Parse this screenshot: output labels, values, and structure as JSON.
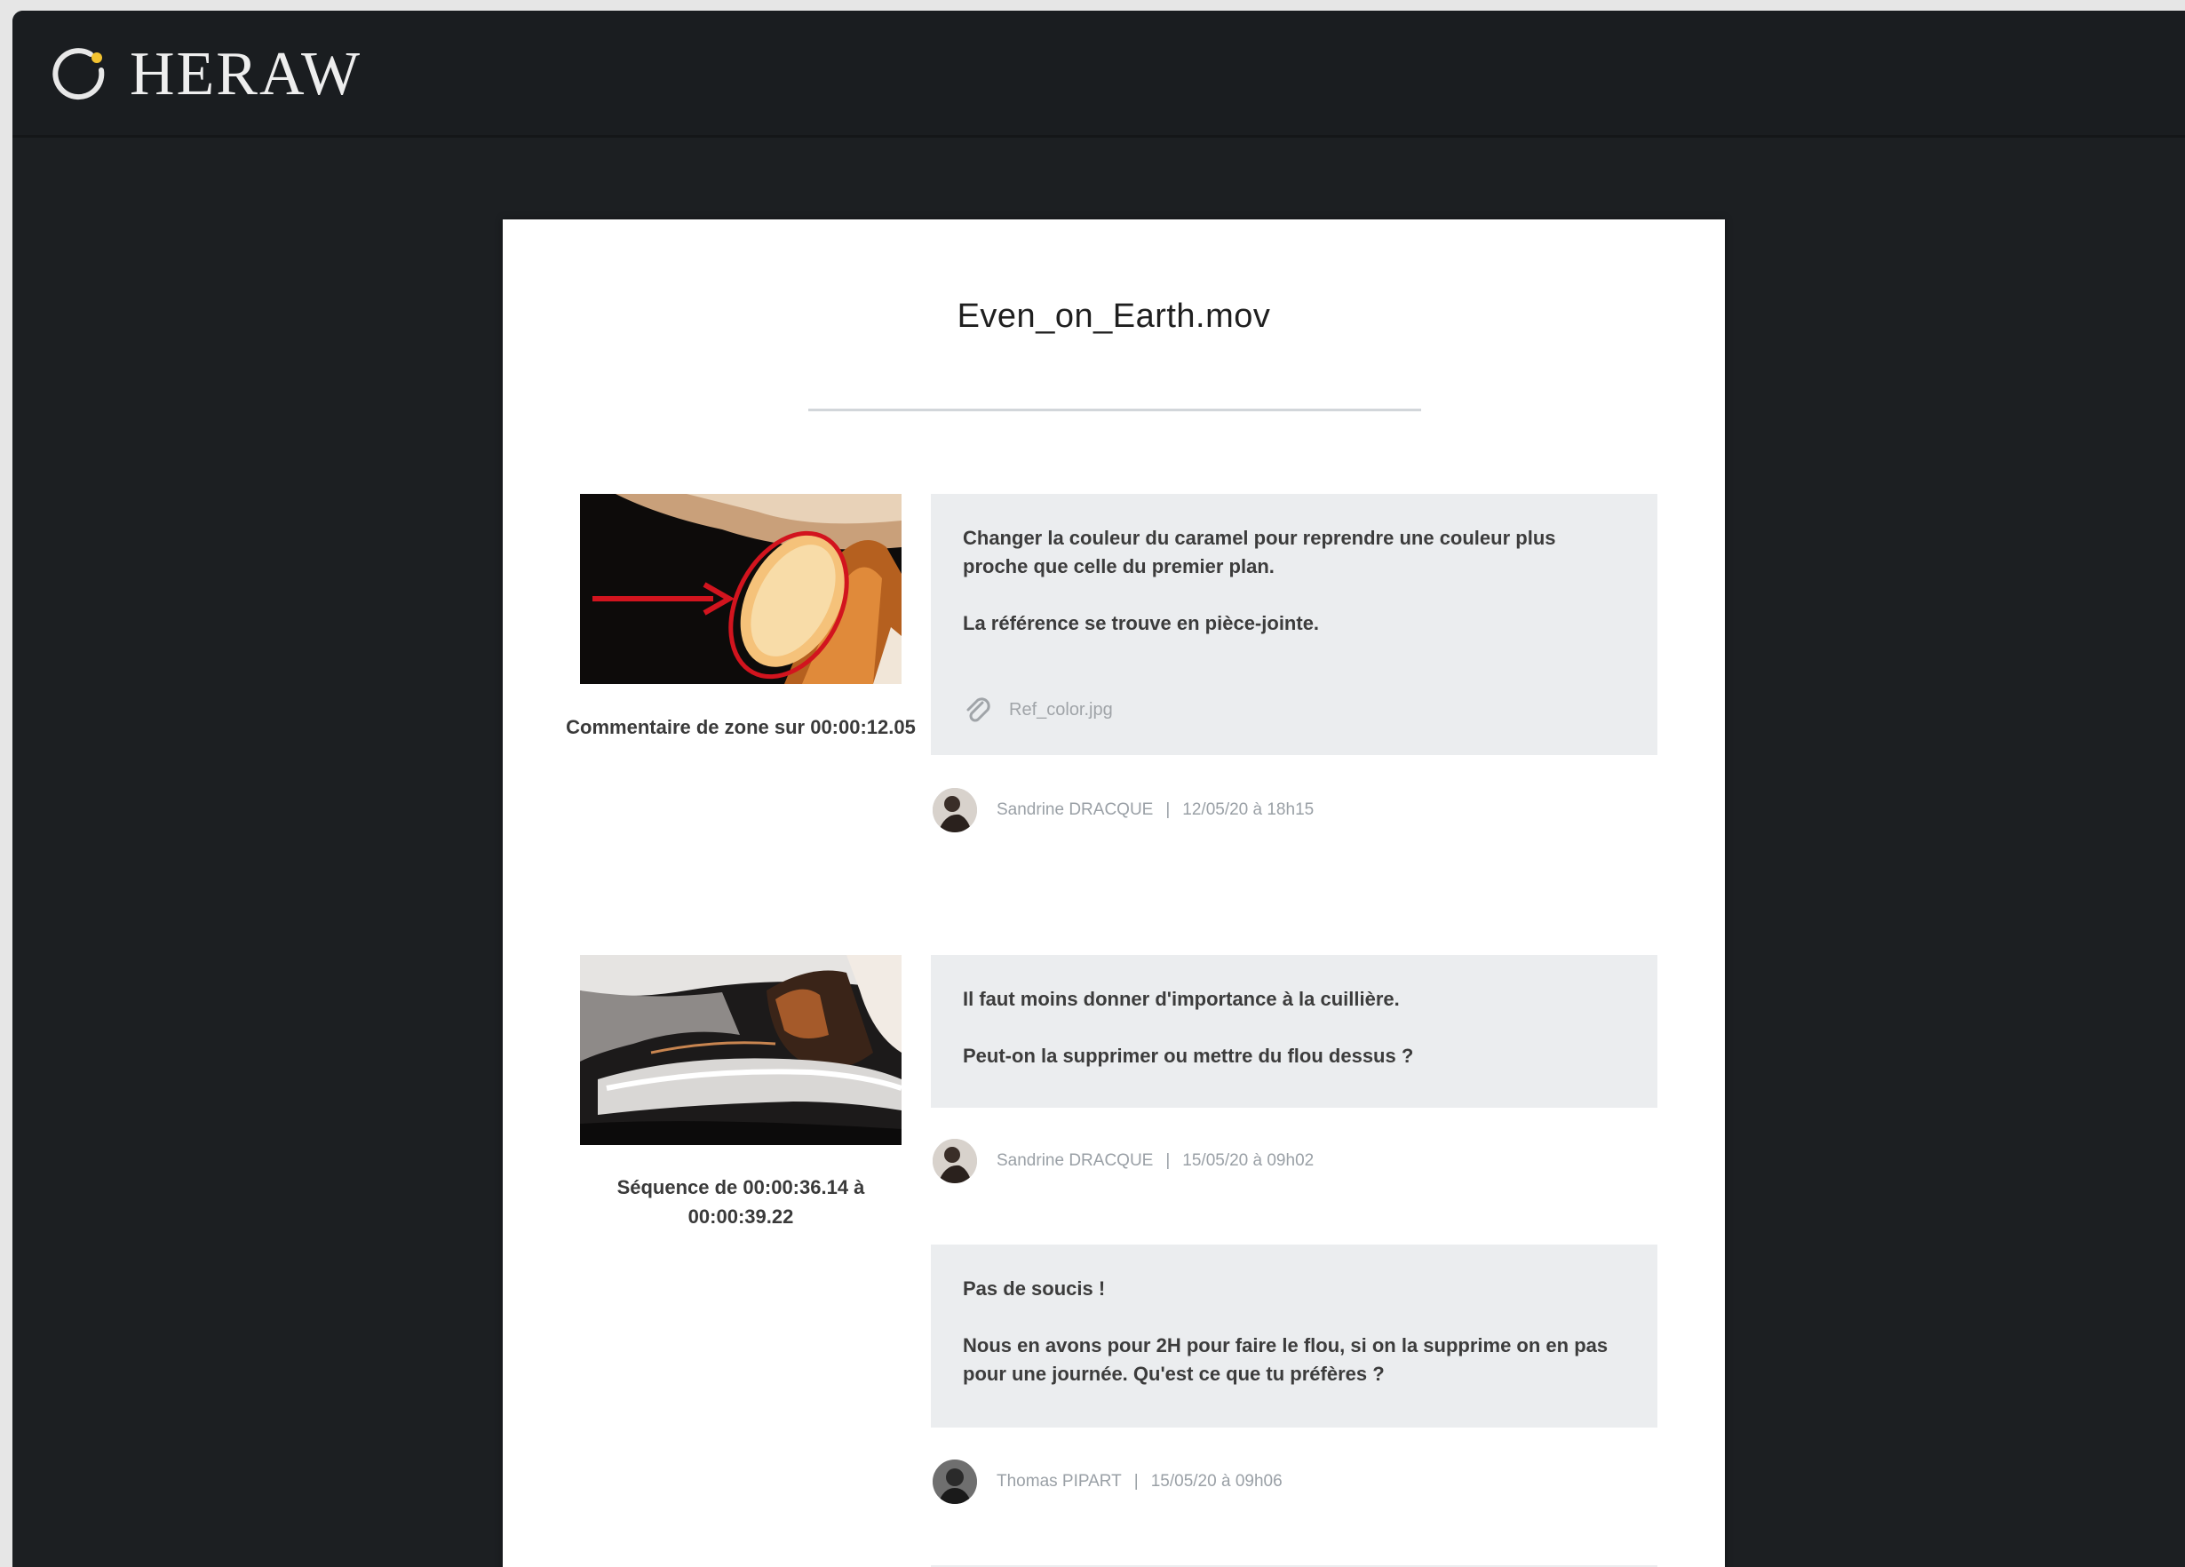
{
  "app": {
    "brand": "HERAW"
  },
  "document": {
    "title": "Even_on_Earth.mov",
    "threads": [
      {
        "thumbnail_caption": "Commentaire de zone sur 00:00:12.05",
        "comments": [
          {
            "paragraphs": [
              "Changer la couleur du caramel pour reprendre une couleur plus proche que celle du premier plan.",
              "La référence se trouve en pièce-jointe."
            ],
            "attachment": "Ref_color.jpg",
            "author": "Sandrine DRACQUE",
            "timestamp": "12/05/20 à 18h15"
          }
        ]
      },
      {
        "thumbnail_caption": "Séquence de 00:00:36.14 à 00:00:39.22",
        "comments": [
          {
            "paragraphs": [
              "Il faut moins donner d'importance à la cuillière.",
              "Peut-on la supprimer ou mettre du flou dessus ?"
            ],
            "author": "Sandrine DRACQUE",
            "timestamp": "15/05/20 à 09h02"
          },
          {
            "paragraphs": [
              "Pas de soucis !",
              "Nous en avons pour 2H pour faire le flou, si on la supprime on en pas pour une journée. Qu'est ce que tu préfères ?"
            ],
            "author": "Thomas PIPART",
            "timestamp": "15/05/20 à 09h06"
          }
        ]
      }
    ]
  },
  "colors": {
    "app_background": "#1c1f22",
    "bubble_background": "#ebedef",
    "annotation_red": "#d2141e",
    "logo_accent": "#f2c230"
  }
}
